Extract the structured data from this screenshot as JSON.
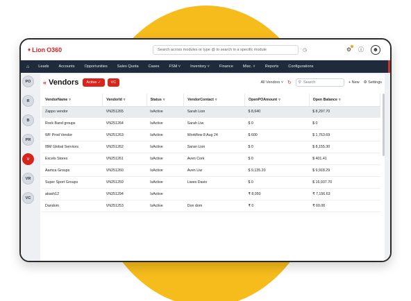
{
  "app": {
    "logo_text": "Lion",
    "logo_num": "O360"
  },
  "search": {
    "placeholder": "Search across modules or type @ to search in a specific module"
  },
  "nav": [
    "Leads",
    "Accounts",
    "Opportunities",
    "Sales Quota",
    "Cases",
    "FSM ˅",
    "Inventory ˅",
    "Finance",
    "Misc. ˅",
    "Reports",
    "Configurations"
  ],
  "rail": [
    "PO",
    "R",
    "B",
    "PR",
    "V",
    "VR",
    "VC"
  ],
  "page": {
    "title": "Vendors",
    "active_btn": "Active ✓",
    "vc_btn": "VC",
    "view_select": "All Vendors",
    "search_placeholder": "Search",
    "new_label": "+ New",
    "settings_label": "Settings"
  },
  "table": {
    "headers": [
      "VendorName",
      "VendorId",
      "Status",
      "VendorContact",
      "OpenPOAmount",
      "Open Balance"
    ],
    "rows": [
      [
        "Zappo vendor",
        "VN251265",
        "IsActive",
        "Sarah Lion",
        "$ 8,640",
        "$ 8,297.70"
      ],
      [
        "Rock Band groups",
        "VN251264",
        "IsActive",
        "Sarah Liw",
        "$ 0",
        "$ 0"
      ],
      [
        "WF Prod Vendor",
        "VN251263",
        "IsActive",
        "Workflow 8 Aug 24",
        "$ 600",
        "$ 1,763.69"
      ],
      [
        "IBM Global Services",
        "VN251262",
        "IsActive",
        "Saran Lion",
        "$ 0",
        "$ 8,155.30"
      ],
      [
        "Excels Stores",
        "VN251261",
        "IsActive",
        "Aven Cork",
        "$ 0",
        "$ 401.41"
      ],
      [
        "Aamca Groups",
        "VN251260",
        "IsActive",
        "Aven Liw",
        "$ 9,135.20",
        "$ 9,918.29"
      ],
      [
        "Super Sport Groups",
        "VN251259",
        "IsActive",
        "Liwes Davis",
        "$ 0",
        "$ 16,937.70"
      ],
      [
        "akash12",
        "VN251294",
        "IsActive",
        "",
        "₹ 8,050",
        "₹ 7,156.63"
      ],
      [
        "Dandom",
        "VN251253",
        "IsActive",
        "Don dom",
        "₹ 0",
        "₹ 60.00"
      ]
    ]
  },
  "colors": {
    "accent": "#d9241b",
    "nav_bg": "#1f2a3c",
    "circle": "#F5BC1C"
  }
}
